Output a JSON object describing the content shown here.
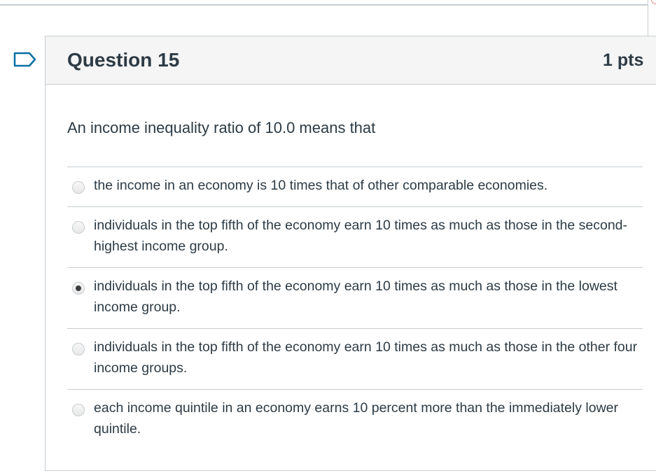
{
  "question": {
    "title": "Question 15",
    "points": "1 pts",
    "text": "An income inequality ratio of 10.0 means that",
    "flag_icon": "flag-outline-icon",
    "answers": [
      {
        "label": "the income in an economy is 10 times that of other comparable economies.",
        "selected": false
      },
      {
        "label": "individuals in the top fifth of the economy earn 10 times as much as those in the second-highest income group.",
        "selected": false
      },
      {
        "label": "individuals in the top fifth of the economy earn 10 times as much as those in the lowest income group.",
        "selected": true
      },
      {
        "label": "individuals in the top fifth of the economy earn 10 times as much as those in the other four income groups.",
        "selected": false
      },
      {
        "label": "each income quintile in an economy earns 10 percent more than the immediately lower quintile.",
        "selected": false
      }
    ]
  },
  "colors": {
    "text": "#2d3b45",
    "border": "#c7cdd1",
    "header_background": "#f5f5f5",
    "flag_accent": "#0770a3"
  }
}
